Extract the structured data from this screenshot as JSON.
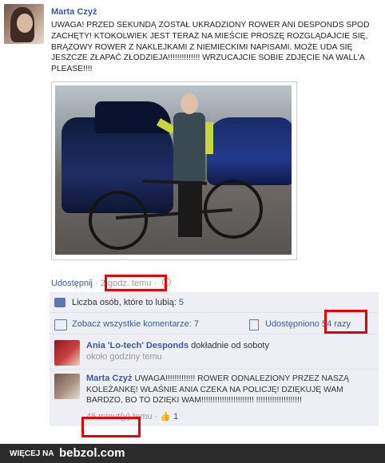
{
  "post": {
    "author": "Marta Czyż",
    "message": "UWAGA! PRZED SEKUNDĄ ZOSTAŁ UKRADZIONY ROWER ANI DESPONDS SPOD ZACHĘTY! KTOKOLWIEK JEST TERAZ NA MIEŚCIE PROSZĘ ROZGLĄDAJCIE SIĘ, BRĄZOWY ROWER Z NAKLEJKAMI Z NIEMIECKIMI NAPISAMI. MOŻE UDA SIĘ JESZCZE ZŁAPAĆ ZŁODZIEJA!!!!!!!!!!!!!! WRZUCAJCIE SOBIE ZDJĘCIE NA WALL'A PLEASE!!!!",
    "share_label": "Udostępnij",
    "separator": "·",
    "time": "2 godz. temu"
  },
  "ufi": {
    "likes_text": "Liczba osób, które to lubią:",
    "likes_count": "5",
    "view_comments": "Zobacz wszystkie komentarze: 7",
    "shared_label": "Udostępniono",
    "shared_count": "54 razy"
  },
  "comments": [
    {
      "author": "Ania 'Lo-tech' Desponds",
      "text": "dokładnie od soboty",
      "time": "około godziny temu"
    },
    {
      "author": "Marta Czyż",
      "text": "UWAGA!!!!!!!!!!!!! ROWER ODNALEZIONY PRZEZ NASZĄ KOLEŻANKĘ! WŁAŚNIE ANIA CZEKA NA POLICJĘ! DZIĘKUJĘ WAM BARDZO, BO TO DZIĘKI WAM!!!!!!!!!!!!!!!!!!!!!!! !!!!!!!!!!!!!!!!!!!!",
      "time": "46 minut(y)",
      "time_suffix": "temu",
      "like_count": "1"
    }
  ],
  "footer": {
    "more_on": "WIĘCEJ NA",
    "site": "bebzol.com"
  },
  "colors": {
    "link": "#3b5998",
    "highlight": "#e00000",
    "ufi_bg": "#edeff4",
    "footer_bg": "#2c2c2c"
  }
}
